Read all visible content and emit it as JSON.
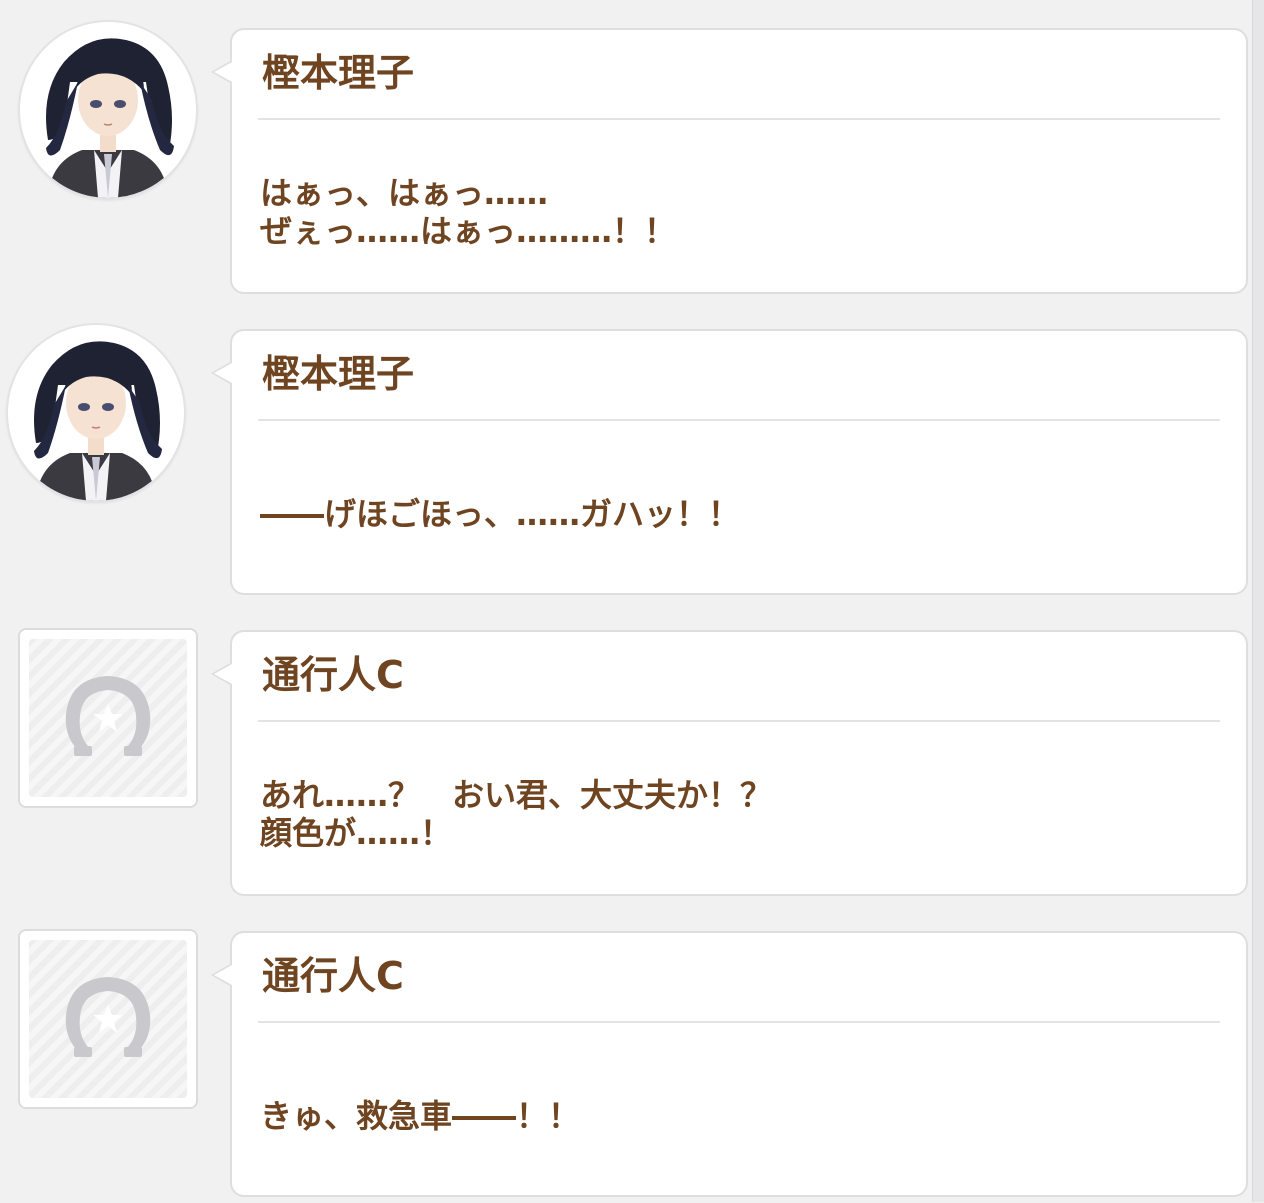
{
  "messages": [
    {
      "speaker": "樫本理子",
      "avatar": "character-portrait",
      "lines": [
        "はぁっ、はぁっ……",
        "ぜぇっ……はぁっ………！！"
      ]
    },
    {
      "speaker": "樫本理子",
      "avatar": "character-portrait",
      "lines": [
        "――げほごほっ、……ガハッ！！"
      ]
    },
    {
      "speaker": "通行人C",
      "avatar": "horseshoe-placeholder-icon",
      "lines": [
        "あれ……？　おい君、大丈夫か！？",
        "顔色が……！"
      ]
    },
    {
      "speaker": "通行人C",
      "avatar": "horseshoe-placeholder-icon",
      "lines": [
        "きゅ、救急車――！！"
      ]
    }
  ],
  "colors": {
    "background": "#f1f1f2",
    "bubble": "#ffffff",
    "text": "#6f4421",
    "border": "#dedee1"
  }
}
